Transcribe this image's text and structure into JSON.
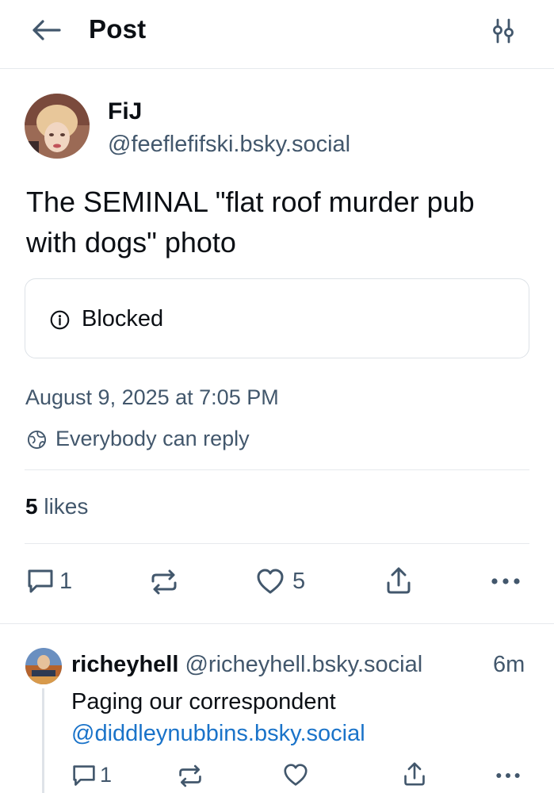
{
  "header": {
    "title": "Post",
    "back_icon": "arrow-left-icon",
    "settings_icon": "sliders-icon"
  },
  "post": {
    "author_name": "FiJ",
    "author_handle": "@feeflefifski.bsky.social",
    "text": "The SEMINAL \"flat roof murder pub with dogs\" photo",
    "embed_label": "Blocked",
    "date": "August 9, 2025 at 7:05 PM",
    "reply_setting": "Everybody can reply",
    "likes_count": "5",
    "likes_label": "likes",
    "actions": {
      "reply_count": "1",
      "like_count": "5"
    }
  },
  "reply": {
    "author_name": "richeyhell",
    "author_handle": "@richeyhell.bsky.social",
    "time": "6m",
    "text": "Paging our correspondent",
    "mention": "@diddleynubbins.bsky.social",
    "actions": {
      "reply_count": "1"
    }
  },
  "colors": {
    "text": "#0b0f14",
    "muted": "#42576c",
    "link": "#1a73c9",
    "border": "#e6e9ed"
  }
}
